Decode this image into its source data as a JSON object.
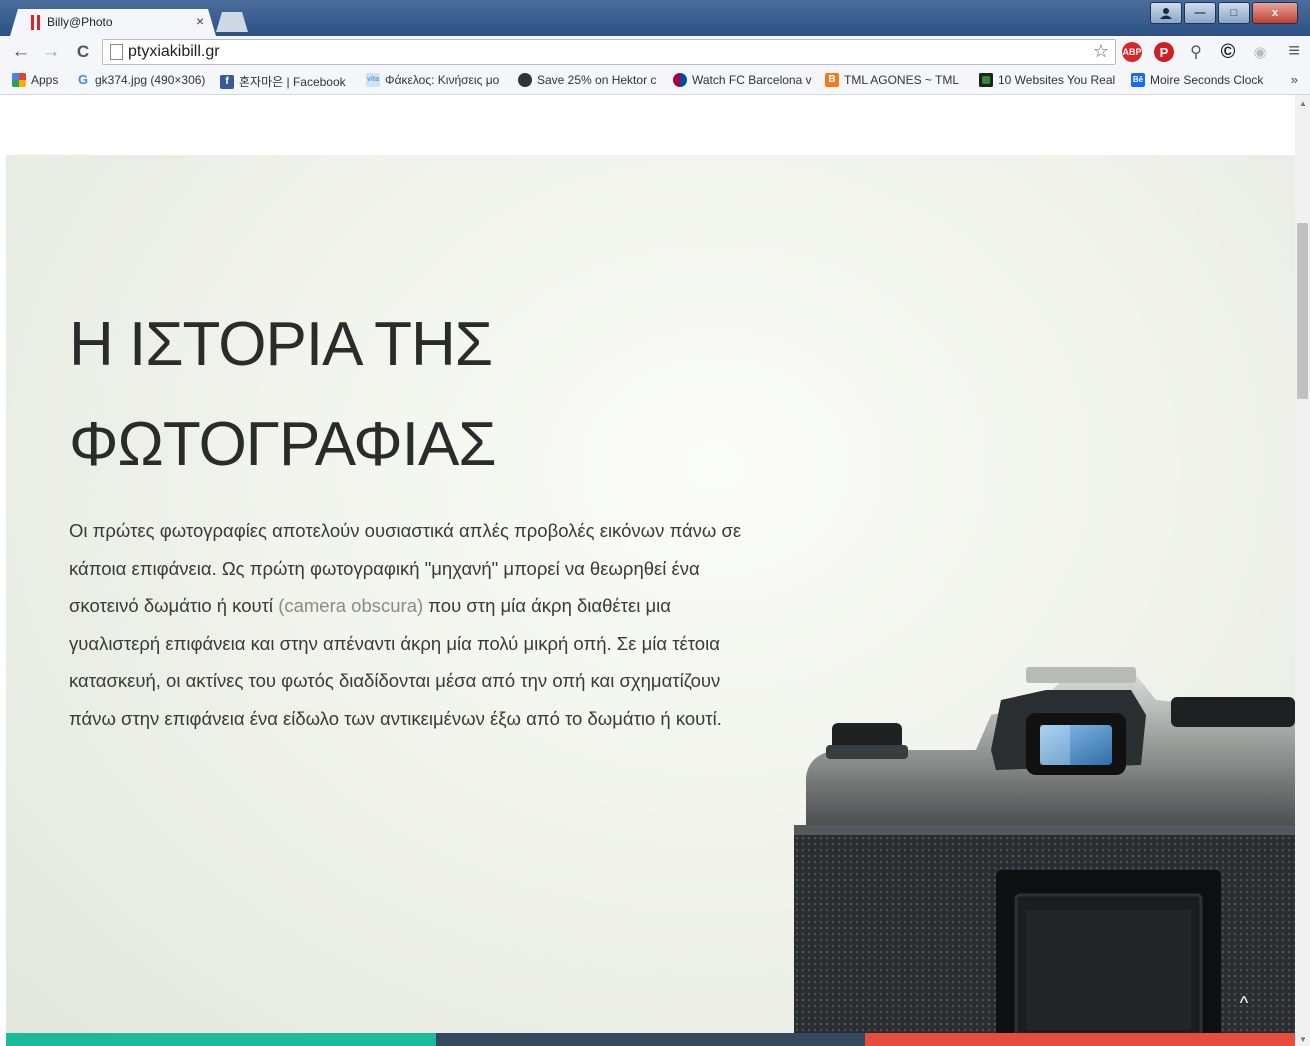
{
  "browser": {
    "tab_title": "Billy@Photo",
    "tab_close": "×",
    "url": "ptyxiakibill.gr",
    "nav": {
      "back": "←",
      "forward": "→",
      "reload": "C"
    },
    "star": "☆",
    "extensions": [
      "ABP",
      "P",
      "⚲",
      "©",
      "◉"
    ],
    "menu": "≡",
    "window_controls": {
      "minimize": "—",
      "maximize": "□",
      "close": "x"
    }
  },
  "bookmarks": [
    {
      "label": "Apps",
      "icon": "apps-grid-icon",
      "color": "#e0a020"
    },
    {
      "label": "gk374.jpg (490×306)",
      "icon": "google-icon",
      "color": "#4285f4"
    },
    {
      "label": "혼자마은 | Facebook",
      "icon": "facebook-icon",
      "color": "#3b5998"
    },
    {
      "label": "Φάκελος: Κινήσεις μο",
      "icon": "vita-icon",
      "color": "#5aa0d8"
    },
    {
      "label": "Save 25% on Hektor c",
      "icon": "steam-icon",
      "color": "#333333"
    },
    {
      "label": "Watch FC Barcelona v",
      "icon": "barca-icon",
      "color": "#b0403a"
    },
    {
      "label": "TML AGONES ~ TML",
      "icon": "blogger-icon",
      "color": "#f07b1a"
    },
    {
      "label": "10 Websites You Real",
      "icon": "green-square-icon",
      "color": "#2e8b2e"
    },
    {
      "label": "Moire Seconds Clock",
      "icon": "behance-icon",
      "color": "#1769ff"
    }
  ],
  "bookmarks_more": "»",
  "hero": {
    "title_line1": "Η ΙΣΤΟΡΙΑ ΤΗΣ",
    "title_line2": "ΦΩΤΟΓΡΑΦΙΑΣ",
    "paragraph_part1": "Οι πρώτες φωτογραφίες αποτελούν ουσιαστικά απλές προβολές εικόνων πάνω σε κάποια επιφάνεια. Ως πρώτη φωτογραφική \"μηχανή\" μπορεί να θεωρηθεί ένα σκοτεινό δωμάτιο ή κουτί ",
    "paragraph_term": "(camera obscura)",
    "paragraph_part2": " που στη μία άκρη διαθέτει μια γυαλιστερή επιφάνεια και στην απέναντι άκρη μία πολύ μικρή οπή. Σε μία τέτοια κατασκευή, οι ακτίνες του φωτός διαδίδονται μέσα από την οπή και σχηματίζουν πάνω στην επιφάνεια ένα είδωλο των αντικειμένων έξω από το δωμάτιο ή κουτί.",
    "back_to_top": "^"
  },
  "colors": {
    "colorbar": [
      "#1abc9c",
      "#34495e",
      "#e74c3c"
    ]
  }
}
